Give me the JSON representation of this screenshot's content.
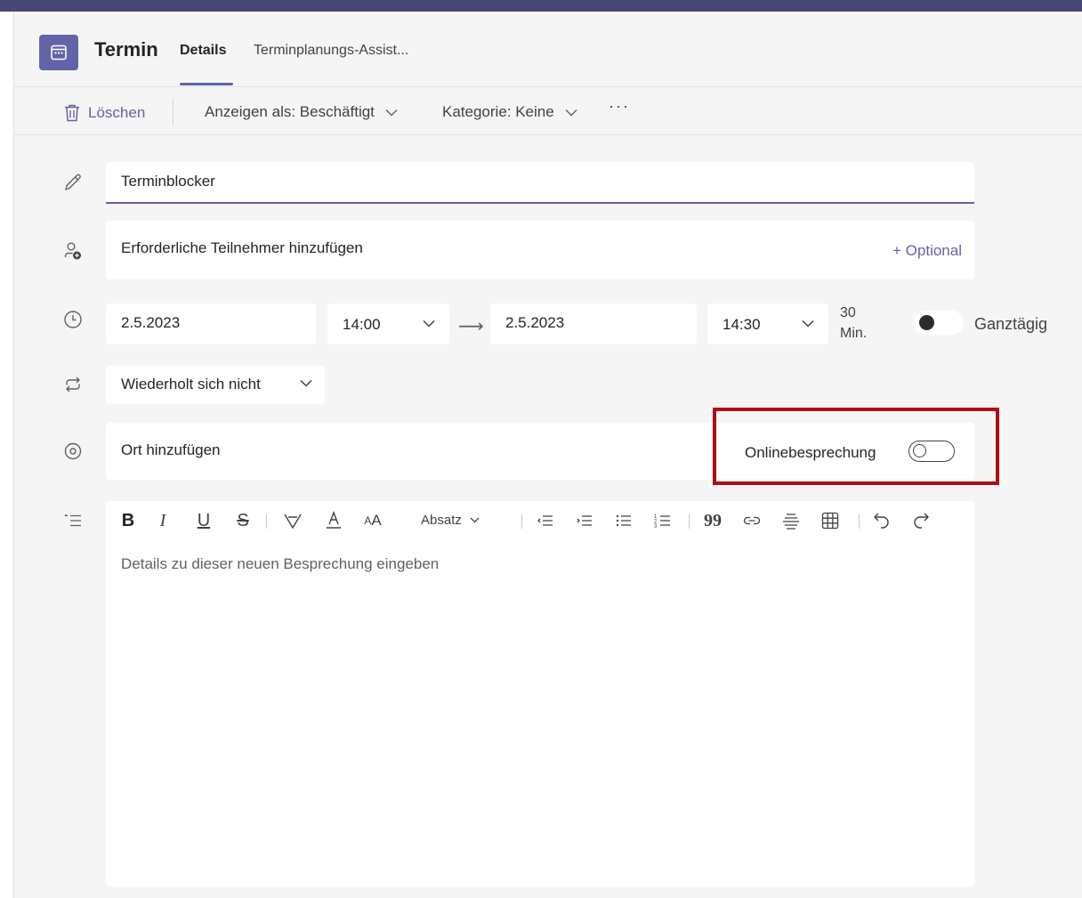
{
  "header": {
    "title": "Termin",
    "tabs": [
      {
        "label": "Details",
        "selected": true
      },
      {
        "label": "Terminplanungs-Assist..."
      }
    ]
  },
  "commandbar": {
    "delete_label": "Löschen",
    "show_as_label": "Anzeigen als: Beschäftigt",
    "category_label": "Kategorie: Keine",
    "more_label": "···"
  },
  "form": {
    "title_value": "Terminblocker",
    "attendees_placeholder": "Erforderliche Teilnehmer hinzufügen",
    "optional_link": "+ Optional",
    "start_date": "2.5.2023",
    "start_time": "14:00",
    "end_date": "2.5.2023",
    "end_time": "14:30",
    "duration_value": "30",
    "duration_unit": "Min.",
    "all_day_label": "Ganztägig",
    "repeat_value": "Wiederholt sich nicht",
    "location_placeholder": "Ort hinzufügen",
    "online_meeting_label": "Onlinebesprechung",
    "online_meeting_on": false,
    "all_day_on": false
  },
  "editor": {
    "paragraph_label": "Absatz",
    "placeholder": "Details zu dieser neuen Besprechung eingeben"
  },
  "colors": {
    "accent": "#6264a7",
    "topbar": "#464775",
    "highlight": "#b00e14"
  }
}
